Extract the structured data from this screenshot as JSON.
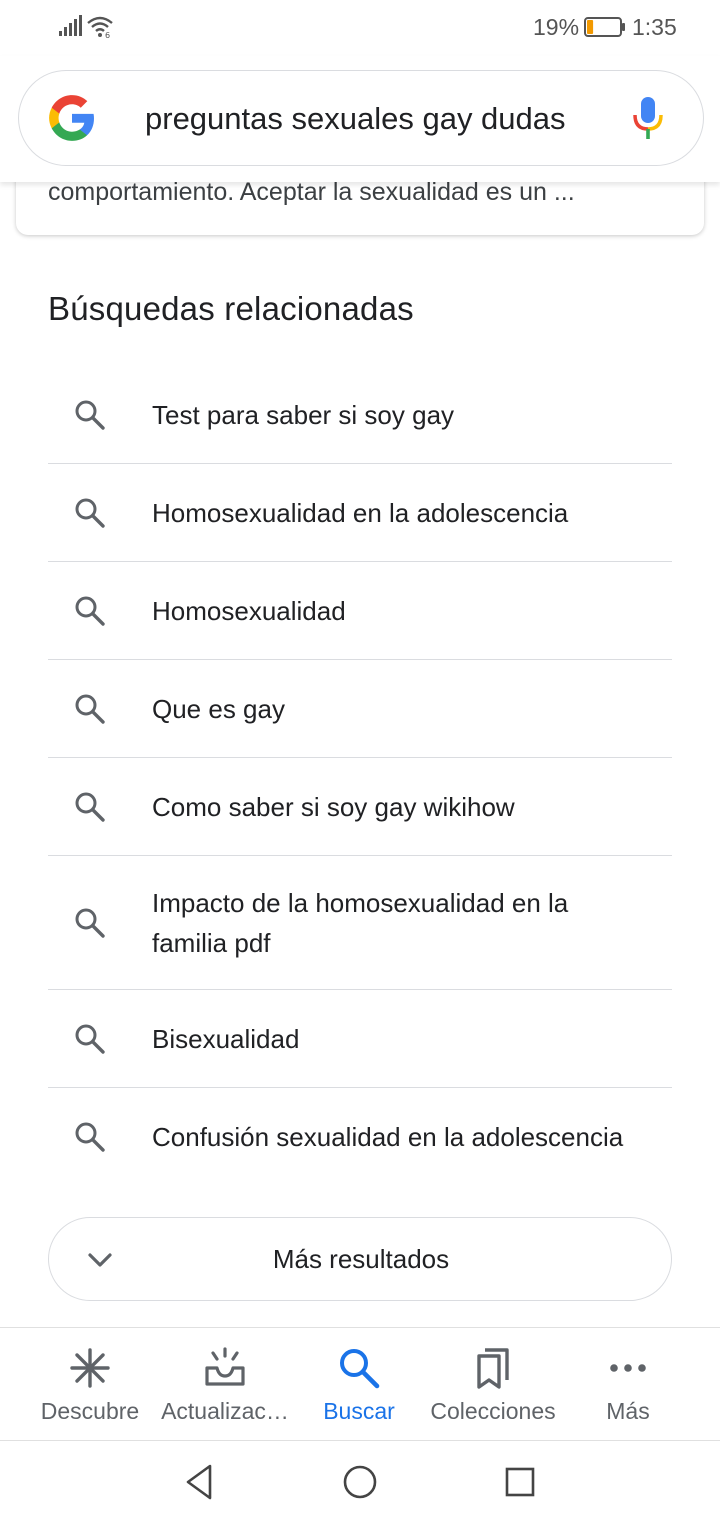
{
  "status_bar": {
    "battery_percent": "19%",
    "battery_level": 0.19,
    "time": "1:35",
    "icons": [
      "signal-icon",
      "wifi-icon",
      "battery-icon"
    ]
  },
  "search": {
    "query": "preguntas sexuales gay dudas",
    "logo": "google-logo",
    "mic": "mic-icon"
  },
  "previous_result": {
    "snippet": "comportamiento. Aceptar la sexualidad es un ..."
  },
  "related": {
    "title": "Búsquedas relacionadas",
    "items": [
      "Test para saber si soy gay",
      "Homosexualidad en la adolescencia",
      "Homosexualidad",
      "Que es gay",
      "Como saber si soy gay wikihow",
      "Impacto de la homosexualidad en la familia pdf",
      "Bisexualidad",
      "Confusión sexualidad en la adolescencia"
    ],
    "more_label": "Más resultados"
  },
  "bottom_nav": {
    "items": [
      {
        "label": "Descubre",
        "icon": "asterisk-icon"
      },
      {
        "label": "Actualizac…",
        "icon": "updates-icon"
      },
      {
        "label": "Buscar",
        "icon": "search-icon"
      },
      {
        "label": "Colecciones",
        "icon": "bookmarks-icon"
      },
      {
        "label": "Más",
        "icon": "more-dots-icon"
      }
    ],
    "active": "Buscar"
  },
  "colors": {
    "accent": "#1a73e8",
    "text": "#202124",
    "secondary": "#5f6368",
    "divider": "#dadce0"
  }
}
